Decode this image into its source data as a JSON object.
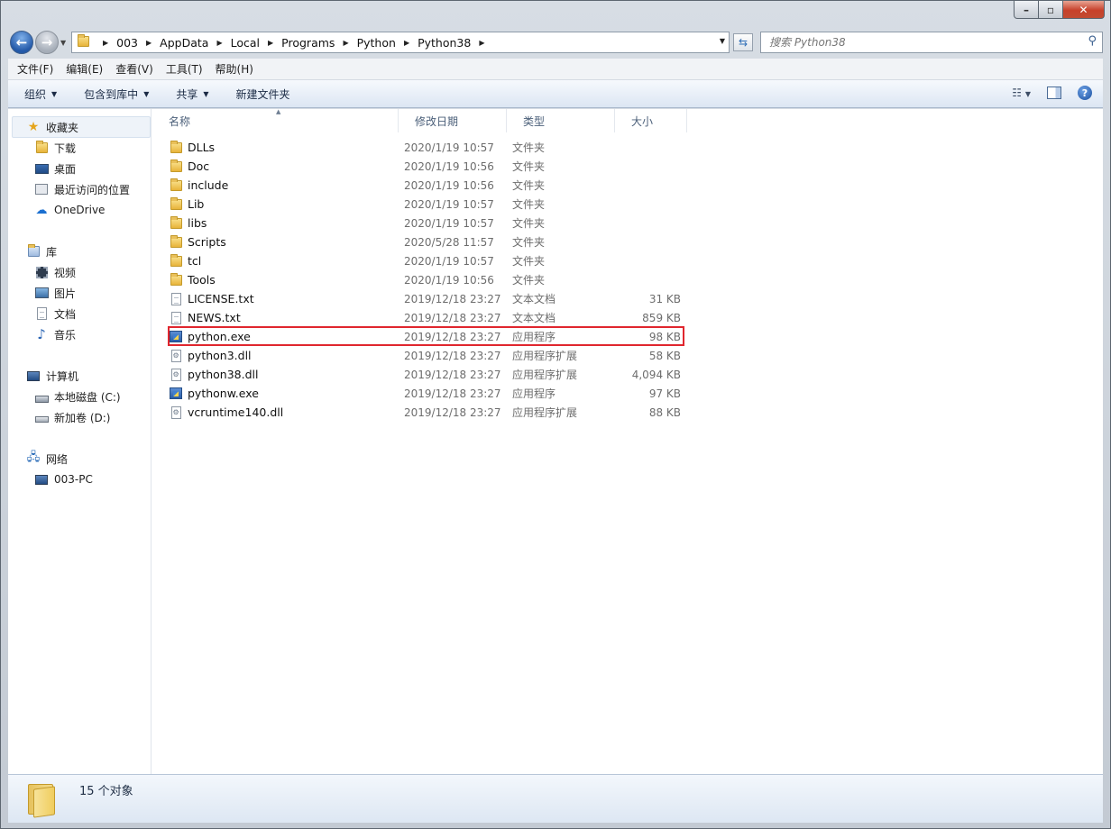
{
  "window": {
    "title_buttons": [
      "minimize",
      "maximize",
      "close"
    ]
  },
  "address": {
    "crumbs": [
      "003",
      "AppData",
      "Local",
      "Programs",
      "Python",
      "Python38"
    ]
  },
  "search": {
    "placeholder": "搜索 Python38"
  },
  "menu": [
    "文件(F)",
    "编辑(E)",
    "查看(V)",
    "工具(T)",
    "帮助(H)"
  ],
  "toolbar": {
    "organize": "组织",
    "include_library": "包含到库中",
    "share": "共享",
    "new_folder": "新建文件夹"
  },
  "nav": {
    "favorites": "收藏夹",
    "downloads": "下载",
    "desktop": "桌面",
    "recent": "最近访问的位置",
    "onedrive": "OneDrive",
    "libraries": "库",
    "videos": "视频",
    "pictures": "图片",
    "documents": "文档",
    "music": "音乐",
    "computer": "计算机",
    "drive_c": "本地磁盘 (C:)",
    "drive_d": "新加卷 (D:)",
    "network": "网络",
    "pc": "003-PC"
  },
  "columns": {
    "name": "名称",
    "date": "修改日期",
    "type": "类型",
    "size": "大小"
  },
  "files": [
    {
      "name": "DLLs",
      "date": "2020/1/19 10:57",
      "type": "文件夹",
      "size": "",
      "icon": "folder"
    },
    {
      "name": "Doc",
      "date": "2020/1/19 10:56",
      "type": "文件夹",
      "size": "",
      "icon": "folder"
    },
    {
      "name": "include",
      "date": "2020/1/19 10:56",
      "type": "文件夹",
      "size": "",
      "icon": "folder"
    },
    {
      "name": "Lib",
      "date": "2020/1/19 10:57",
      "type": "文件夹",
      "size": "",
      "icon": "folder"
    },
    {
      "name": "libs",
      "date": "2020/1/19 10:57",
      "type": "文件夹",
      "size": "",
      "icon": "folder"
    },
    {
      "name": "Scripts",
      "date": "2020/5/28 11:57",
      "type": "文件夹",
      "size": "",
      "icon": "folder"
    },
    {
      "name": "tcl",
      "date": "2020/1/19 10:57",
      "type": "文件夹",
      "size": "",
      "icon": "folder"
    },
    {
      "name": "Tools",
      "date": "2020/1/19 10:56",
      "type": "文件夹",
      "size": "",
      "icon": "folder"
    },
    {
      "name": "LICENSE.txt",
      "date": "2019/12/18 23:27",
      "type": "文本文档",
      "size": "31 KB",
      "icon": "text"
    },
    {
      "name": "NEWS.txt",
      "date": "2019/12/18 23:27",
      "type": "文本文档",
      "size": "859 KB",
      "icon": "text"
    },
    {
      "name": "python.exe",
      "date": "2019/12/18 23:27",
      "type": "应用程序",
      "size": "98 KB",
      "icon": "exe"
    },
    {
      "name": "python3.dll",
      "date": "2019/12/18 23:27",
      "type": "应用程序扩展",
      "size": "58 KB",
      "icon": "dll"
    },
    {
      "name": "python38.dll",
      "date": "2019/12/18 23:27",
      "type": "应用程序扩展",
      "size": "4,094 KB",
      "icon": "dll"
    },
    {
      "name": "pythonw.exe",
      "date": "2019/12/18 23:27",
      "type": "应用程序",
      "size": "97 KB",
      "icon": "exe"
    },
    {
      "name": "vcruntime140.dll",
      "date": "2019/12/18 23:27",
      "type": "应用程序扩展",
      "size": "88 KB",
      "icon": "dll"
    }
  ],
  "highlighted_file": "python.exe",
  "status": {
    "count": "15 个对象"
  }
}
